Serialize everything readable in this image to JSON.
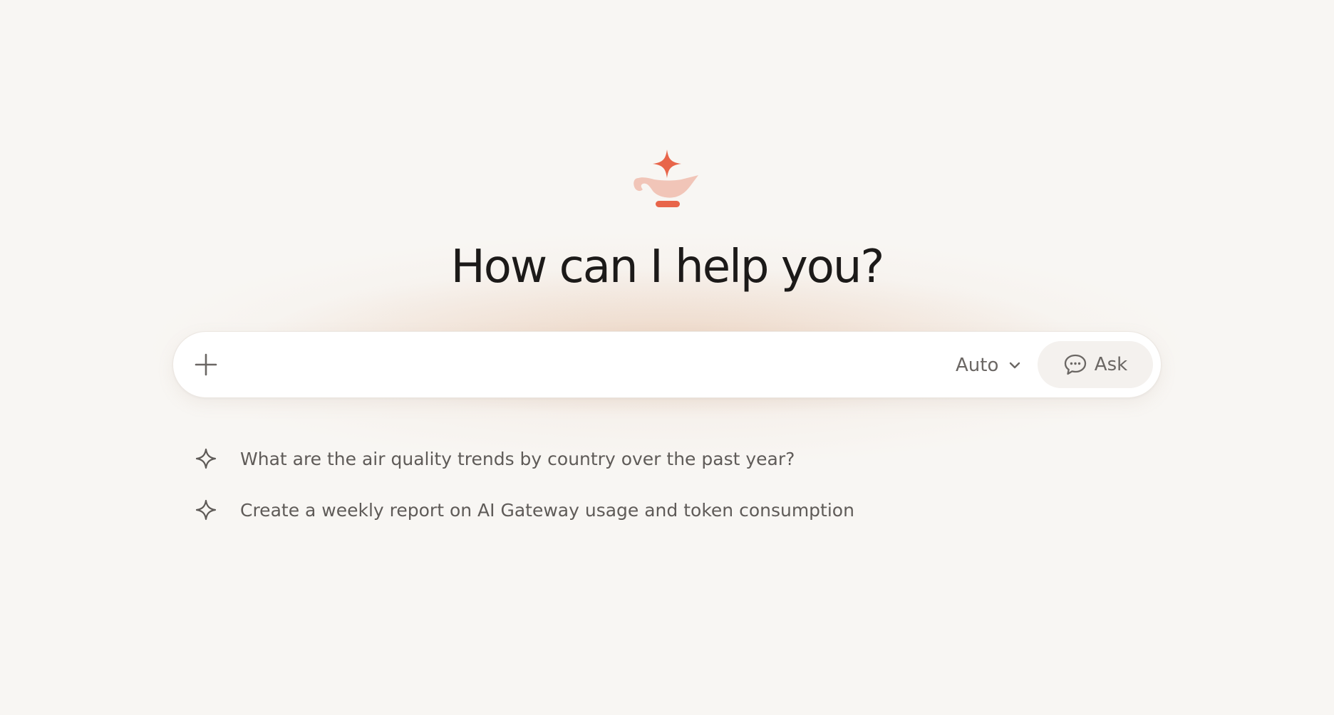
{
  "header": {
    "title": "How can I help you?"
  },
  "composer": {
    "input_value": "",
    "input_placeholder": "",
    "mode_label": "Auto",
    "ask_label": "Ask"
  },
  "suggestions": [
    {
      "text": "What are the air quality trends by country over the past year?"
    },
    {
      "text": "Create a weekly report on AI Gateway usage and token consumption"
    }
  ],
  "icons": {
    "logo": "genie-lamp-sparkle-icon",
    "add": "plus-icon",
    "mode": "chevron-down-icon",
    "ask": "chat-bubble-icon",
    "suggestion": "sparkle-icon"
  },
  "colors": {
    "accent": "#e8654a",
    "accent_light": "#f1c5b8",
    "background": "#f8f6f3"
  }
}
